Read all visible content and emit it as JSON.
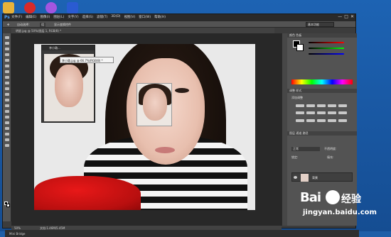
{
  "app": {
    "title": "Ps",
    "menus": [
      "文件(F)",
      "编辑(E)",
      "图像(I)",
      "图层(L)",
      "文字(Y)",
      "选择(S)",
      "滤镜(T)",
      "3D(D)",
      "视图(V)",
      "窗口(W)",
      "帮助(H)"
    ],
    "window_controls": [
      "—",
      "□",
      "✕"
    ]
  },
  "options_bar": {
    "auto_select": "自动选择：",
    "layer_dropdown": "组",
    "transform": "显示变换控件",
    "workspace": "基本功能"
  },
  "document_tab": {
    "label": "明星.jpg @ 50%(图层 1, RGB/8) *"
  },
  "floating_window": {
    "title": "李小璐...",
    "tooltip": "李小璐.jpg @ 66.7%(RGB/8) *"
  },
  "status_bar": {
    "zoom": "50%",
    "doc_info": "文档:1.46M/5.45M"
  },
  "bottom": {
    "mini_bridge": "Mini Bridge"
  },
  "panels": {
    "color_tab": "颜色",
    "swatches_tab": "色板",
    "adjustments_tab": "调整",
    "styles_tab": "样式",
    "add_adjustment": "添加调整",
    "layers_tab": "图层",
    "channels_tab": "通道",
    "paths_tab": "路径",
    "blend_mode": "正常",
    "opacity_label": "不透明度:",
    "lock_label": "锁定:",
    "fill_label": "填充:",
    "layer_name": "背景"
  },
  "watermark": {
    "brand": "Bai",
    "brand2": "经验",
    "url": "jingyan.baidu.com"
  },
  "colors": {
    "desktop": "#1d63b3",
    "ps_dark": "#3c3c3c",
    "ps_panel": "#535353"
  }
}
